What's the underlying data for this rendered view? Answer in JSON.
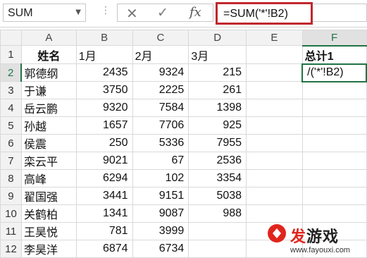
{
  "formula_bar": {
    "name_box": "SUM",
    "formula": "=SUM('*'!B2)",
    "icons": [
      "close-icon",
      "check-icon",
      "fx-icon"
    ]
  },
  "sheet": {
    "columns": [
      "A",
      "B",
      "C",
      "D",
      "E",
      "F"
    ],
    "header_row": {
      "row": "1",
      "a": "姓名",
      "b": "1月",
      "c": "2月",
      "d": "3月",
      "e": "",
      "f": "总计1"
    },
    "rows": [
      {
        "row": "2",
        "name": "郭德纲",
        "b": "2435",
        "c": "9324",
        "d": "215",
        "f": "/('*'!B2)"
      },
      {
        "row": "3",
        "name": "于谦",
        "b": "3750",
        "c": "2225",
        "d": "261"
      },
      {
        "row": "4",
        "name": "岳云鹏",
        "b": "9320",
        "c": "7584",
        "d": "1398"
      },
      {
        "row": "5",
        "name": "孙越",
        "b": "1657",
        "c": "7706",
        "d": "925"
      },
      {
        "row": "6",
        "name": "侯震",
        "b": "250",
        "c": "5336",
        "d": "7955"
      },
      {
        "row": "7",
        "name": "栾云平",
        "b": "9021",
        "c": "67",
        "d": "2536"
      },
      {
        "row": "8",
        "name": "高峰",
        "b": "6294",
        "c": "102",
        "d": "3354"
      },
      {
        "row": "9",
        "name": "翟国强",
        "b": "3441",
        "c": "9151",
        "d": "5038"
      },
      {
        "row": "10",
        "name": "关鹤柏",
        "b": "1341",
        "c": "9087",
        "d": "988"
      },
      {
        "row": "11",
        "name": "王昊悦",
        "b": "781",
        "c": "3999",
        "d": ""
      },
      {
        "row": "12",
        "name": "李昊洋",
        "b": "6874",
        "c": "6734",
        "d": ""
      }
    ]
  },
  "watermark": {
    "title_a": "发",
    "title_b": "游戏",
    "url": "www.fayouxi.com"
  },
  "colors": {
    "accent_green": "#217346",
    "formula_highlight": "#c0282d",
    "watermark_red": "#e0251d"
  }
}
